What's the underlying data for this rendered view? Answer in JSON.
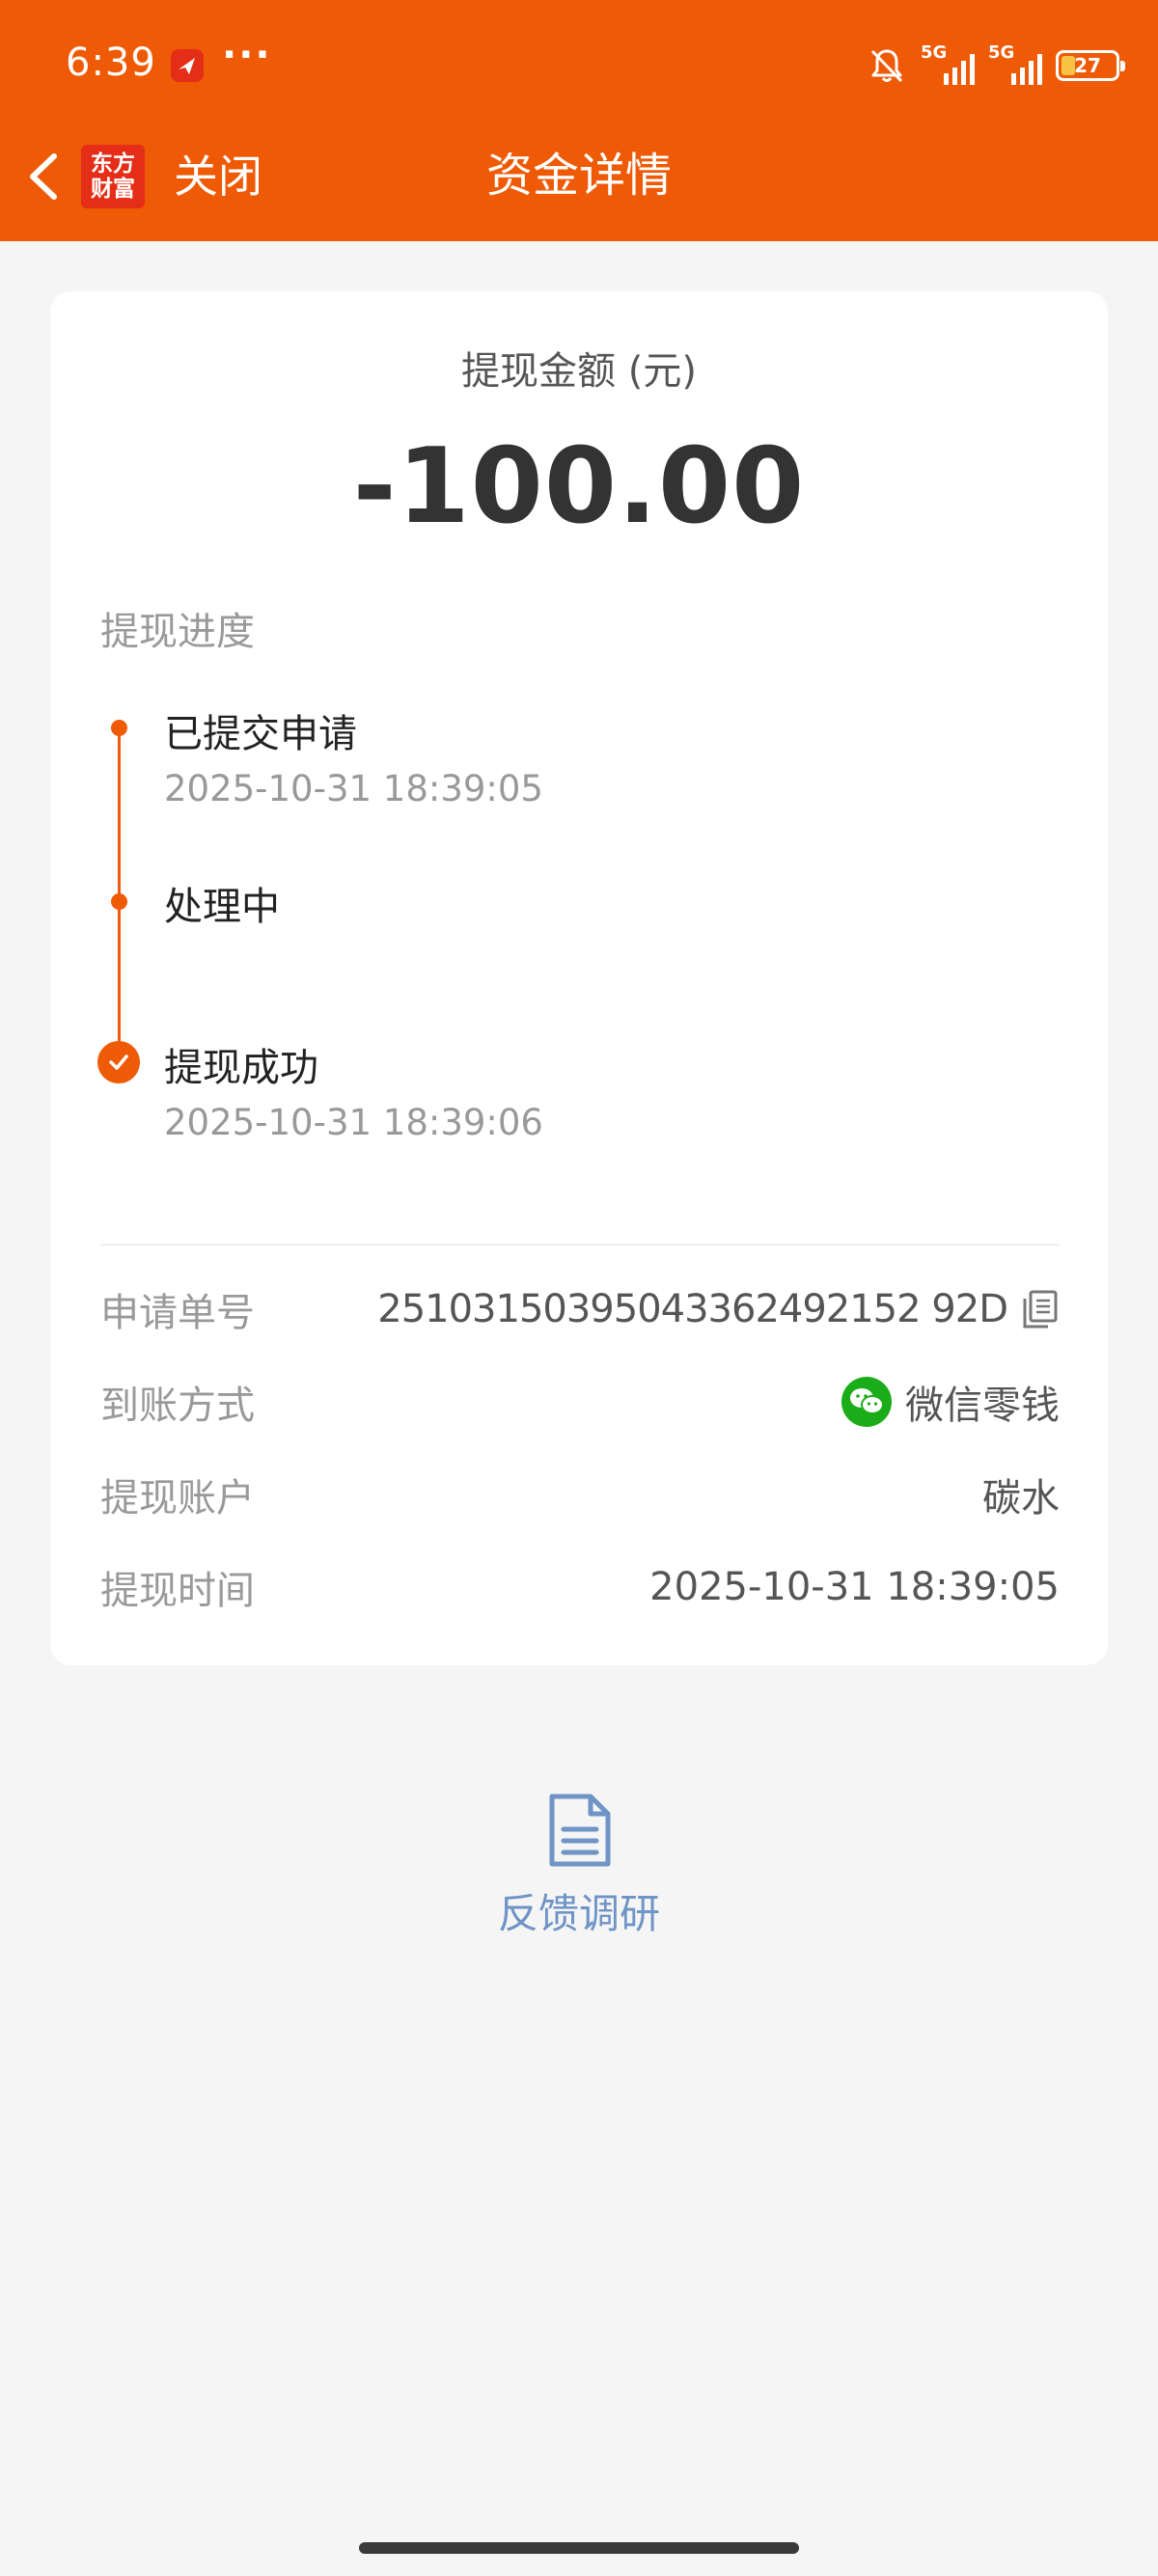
{
  "status_bar": {
    "time": "6:39",
    "more": "···",
    "signal_1": "5G",
    "signal_2": "5G",
    "battery": "27"
  },
  "nav": {
    "logo_line1": "东方",
    "logo_line2": "财富",
    "close_label": "关闭",
    "title": "资金详情"
  },
  "amount": {
    "label": "提现金额 (元)",
    "value": "-100.00"
  },
  "progress": {
    "title": "提现进度",
    "steps": [
      {
        "label": "已提交申请",
        "time": "2025-10-31 18:39:05"
      },
      {
        "label": "处理中",
        "time": ""
      },
      {
        "label": "提现成功",
        "time": "2025-10-31 18:39:06"
      }
    ]
  },
  "details": {
    "order_no_label": "申请单号",
    "order_no_value": "25103150395043362492152 92D",
    "method_label": "到账方式",
    "method_value": "微信零钱",
    "account_label": "提现账户",
    "account_value": "碳水",
    "time_label": "提现时间",
    "time_value": "2025-10-31 18:39:05"
  },
  "feedback": {
    "label": "反馈调研"
  },
  "colors": {
    "brand": "#ee5a06",
    "link": "#6f94c6",
    "wechat": "#1aad19"
  }
}
